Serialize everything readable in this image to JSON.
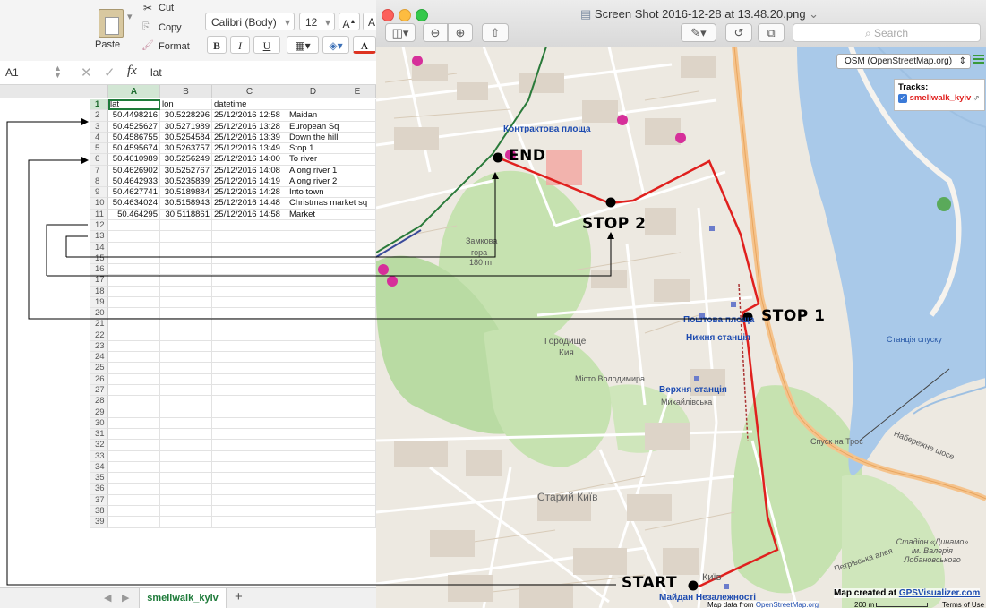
{
  "excel": {
    "ribbon": {
      "paste": "Paste",
      "cut": "Cut",
      "copy": "Copy",
      "format": "Format",
      "font_name": "Calibri (Body)",
      "font_size": "12",
      "bold": "B",
      "italic": "I",
      "underline": "U",
      "grow_font": "A",
      "font_color": "A"
    },
    "formula_bar": {
      "cell_ref": "A1",
      "fx": "fx",
      "value": "lat"
    },
    "columns": [
      "A",
      "B",
      "C",
      "D",
      "E"
    ],
    "headers": [
      "lat",
      "lon",
      "datetime",
      "",
      ""
    ],
    "rows": [
      [
        "50.4498216",
        "30.5228296",
        "25/12/2016 12:58",
        "Maidan"
      ],
      [
        "50.4525627",
        "30.5271989",
        "25/12/2016 13:28",
        "European Sq"
      ],
      [
        "50.4586755",
        "30.5254584",
        "25/12/2016 13:39",
        "Down the hill"
      ],
      [
        "50.4595674",
        "30.5263757",
        "25/12/2016 13:49",
        "Stop 1"
      ],
      [
        "50.4610989",
        "30.5256249",
        "25/12/2016 14:00",
        "To river"
      ],
      [
        "50.4626902",
        "30.5252767",
        "25/12/2016 14:08",
        "Along river 1"
      ],
      [
        "50.4642933",
        "30.5235839",
        "25/12/2016 14:19",
        "Along river 2"
      ],
      [
        "50.4627741",
        "30.5189884",
        "25/12/2016 14:28",
        "Into town"
      ],
      [
        "50.4634024",
        "30.5158943",
        "25/12/2016 14:48",
        "Christmas market sq"
      ],
      [
        "50.464295",
        "30.5118861",
        "25/12/2016 14:58",
        "Market"
      ]
    ],
    "row_count": 39,
    "sheet_tab": "smellwalk_kyiv",
    "add_sheet": "+"
  },
  "preview": {
    "title": "Screen Shot 2016-12-28 at 13.48.20.png",
    "search_placeholder": "Search"
  },
  "map": {
    "layer_select": "OSM (OpenStreetMap.org)",
    "tracks_title": "Tracks:",
    "track_name": "smellwalk_kyiv",
    "labels": {
      "end": "END",
      "stop2": "STOP 2",
      "stop1": "STOP 1",
      "start": "START"
    },
    "place_names": {
      "kontraktova": "Контрактова площа",
      "zamkova": "Замкова",
      "hora": "гора",
      "elev": "180 m",
      "poshtova": "Поштова площа",
      "nyzhnia": "Нижня станція",
      "horodyshche": "Городище",
      "kyia": "Кия",
      "misto": "Місто Володимира",
      "verkhnia": "Верхня станція",
      "mykhailivska": "Михайлівська",
      "staryi": "Старий Київ",
      "spusk": "Спуск на Трос",
      "stantsiia_spusku": "Станція спуску",
      "maidan": "Майдан Незалежності",
      "kyiv": "Київ",
      "naberezhne": "Набережне шосе",
      "petrivska": "Петрівська алея",
      "stadion": "Стадіон «Динамо» ім. Валерія Лобановського"
    },
    "credit": "Map created at",
    "credit_link": "GPSVisualizer.com",
    "data_credit": "Map data from",
    "data_link": "OpenStreetMap.org",
    "scale": "200 m",
    "terms": "Terms of Use"
  },
  "colors": {
    "track": "#e0201e",
    "excel_green": "#1e7b3a",
    "river": "#a9c9e9",
    "park": "#c6e2b0"
  }
}
